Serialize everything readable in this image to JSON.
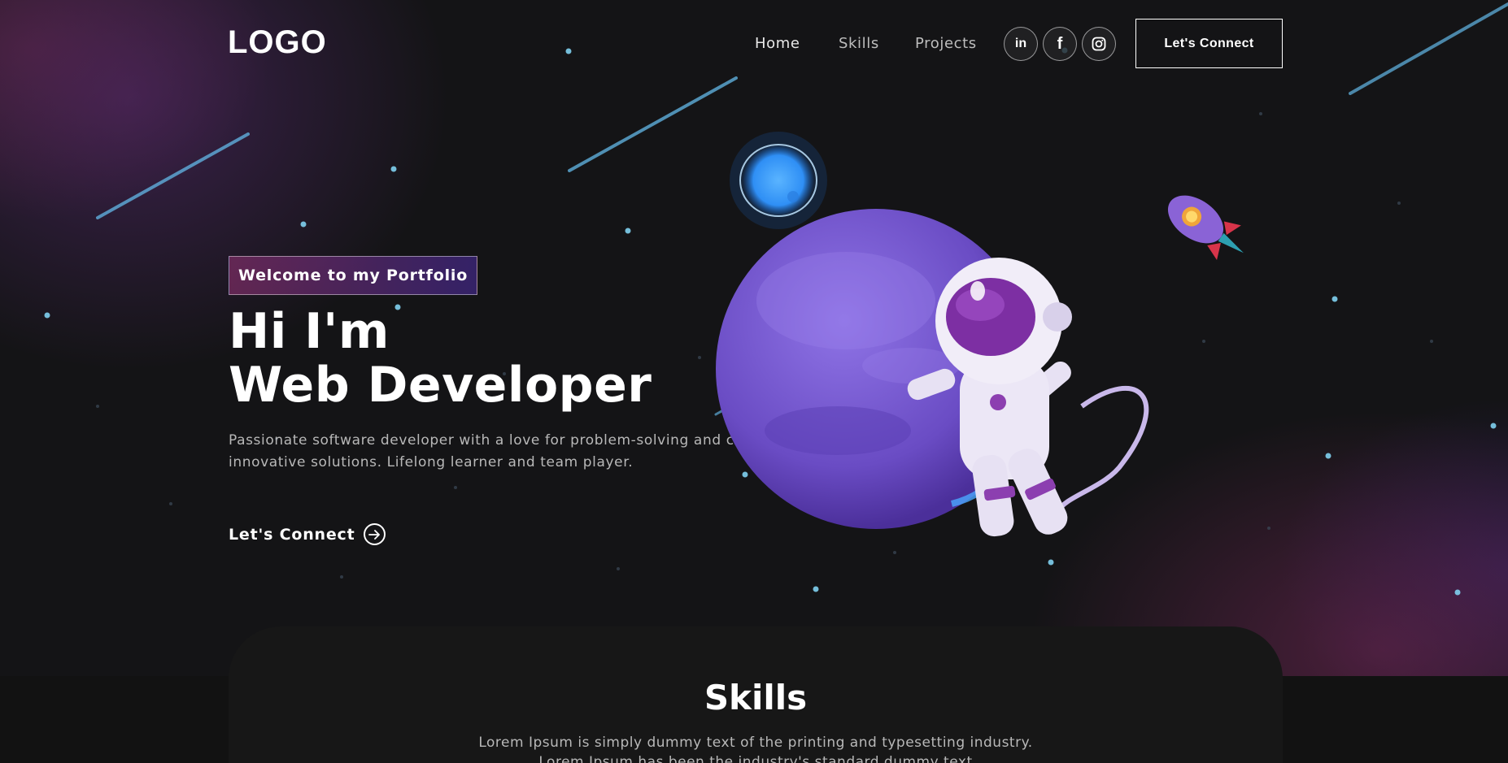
{
  "navbar": {
    "logo": "LOGO",
    "links": [
      {
        "label": "Home"
      },
      {
        "label": "Skills"
      },
      {
        "label": "Projects"
      }
    ],
    "social": [
      {
        "icon": "linkedin-icon",
        "glyph": "in"
      },
      {
        "icon": "facebook-icon",
        "glyph": "f"
      },
      {
        "icon": "instagram-icon"
      }
    ],
    "connect_label": "Let's Connect"
  },
  "hero": {
    "tagline": "Welcome to my Portfolio",
    "headline_line1": "Hi I'm",
    "headline_line2": "Web Developer",
    "intro_line1": "Passionate software developer with a love for problem-solving and creating",
    "intro_line2": "innovative solutions. Lifelong learner and team player.",
    "cta_label": "Let's Connect"
  },
  "skills": {
    "title": "Skills",
    "text_line1": "Lorem Ipsum is simply dummy text of the printing and typesetting industry.",
    "text_line2": "Lorem Ipsum has been the industry's standard dummy text"
  },
  "colors": {
    "background": "#121212",
    "accent_gradient_start": "#AA367C",
    "accent_gradient_end": "#4A2FBD",
    "planet": "#7b5ccf"
  }
}
